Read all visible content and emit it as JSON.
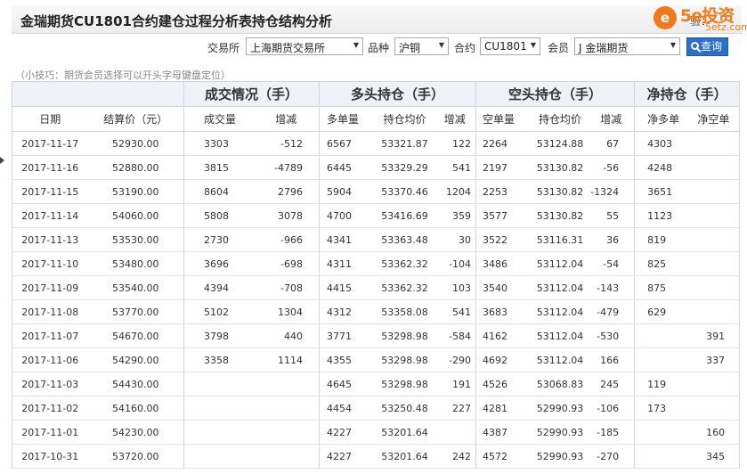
{
  "title": "金瑞期货CU1801合约建仓过程分析表持仓结构分析",
  "title_partial": "验：",
  "logo": {
    "badge": "e",
    "brand": "5e投资",
    "domain": "5etz.com"
  },
  "filters": {
    "exchange_label": "交易所",
    "exchange_value": "上海期货交易所",
    "variety_label": "品种",
    "variety_value": "沪铜",
    "contract_label": "合约",
    "contract_value": "CU1801",
    "member_label": "会员",
    "member_value": "J 金瑞期货",
    "query_label": "查询"
  },
  "tip": "（小技巧：期货会员选择可以开头字母键盘定位）",
  "table": {
    "groups": [
      "成交情况（手）",
      "多头持仓（手）",
      "空头持仓（手）",
      "净持仓（手）"
    ],
    "columns": [
      "日期",
      "结算价（元）",
      "成交量",
      "增减",
      "多单量",
      "持仓均价",
      "增减",
      "空单量",
      "持仓均价",
      "增减",
      "净多单",
      "净空单"
    ],
    "rows": [
      [
        "2017-11-17",
        "52930.00",
        "3303",
        "-512",
        "6567",
        "53321.87",
        "122",
        "2264",
        "53124.88",
        "67",
        "4303",
        ""
      ],
      [
        "2017-11-16",
        "52880.00",
        "3815",
        "-4789",
        "6445",
        "53329.29",
        "541",
        "2197",
        "53130.82",
        "-56",
        "4248",
        ""
      ],
      [
        "2017-11-15",
        "53190.00",
        "8604",
        "2796",
        "5904",
        "53370.46",
        "1204",
        "2253",
        "53130.82",
        "-1324",
        "3651",
        ""
      ],
      [
        "2017-11-14",
        "54060.00",
        "5808",
        "3078",
        "4700",
        "53416.69",
        "359",
        "3577",
        "53130.82",
        "55",
        "1123",
        ""
      ],
      [
        "2017-11-13",
        "53530.00",
        "2730",
        "-966",
        "4341",
        "53363.48",
        "30",
        "3522",
        "53116.31",
        "36",
        "819",
        ""
      ],
      [
        "2017-11-10",
        "53480.00",
        "3696",
        "-698",
        "4311",
        "53362.32",
        "-104",
        "3486",
        "53112.04",
        "-54",
        "825",
        ""
      ],
      [
        "2017-11-09",
        "53540.00",
        "4394",
        "-708",
        "4415",
        "53362.32",
        "103",
        "3540",
        "53112.04",
        "-143",
        "875",
        ""
      ],
      [
        "2017-11-08",
        "53770.00",
        "5102",
        "1304",
        "4312",
        "53358.08",
        "541",
        "3683",
        "53112.04",
        "-479",
        "629",
        ""
      ],
      [
        "2017-11-07",
        "54670.00",
        "3798",
        "440",
        "3771",
        "53298.98",
        "-584",
        "4162",
        "53112.04",
        "-530",
        "",
        "391"
      ],
      [
        "2017-11-06",
        "54290.00",
        "3358",
        "1114",
        "4355",
        "53298.98",
        "-290",
        "4692",
        "53112.04",
        "166",
        "",
        "337"
      ],
      [
        "2017-11-03",
        "54430.00",
        "",
        "",
        "4645",
        "53298.98",
        "191",
        "4526",
        "53068.83",
        "245",
        "119",
        ""
      ],
      [
        "2017-11-02",
        "54160.00",
        "",
        "",
        "4454",
        "53250.48",
        "227",
        "4281",
        "52990.93",
        "-106",
        "173",
        ""
      ],
      [
        "2017-11-01",
        "54230.00",
        "",
        "",
        "4227",
        "53201.64",
        "",
        "4387",
        "52990.93",
        "-185",
        "",
        "160"
      ],
      [
        "2017-10-31",
        "53720.00",
        "",
        "",
        "4227",
        "53201.64",
        "242",
        "4572",
        "52990.93",
        "-270",
        "",
        "345"
      ]
    ]
  },
  "colors": {
    "up": "#e00000",
    "down": "#0a9a0a",
    "accent": "#2c6fc7",
    "logo": "#f07a1a"
  }
}
